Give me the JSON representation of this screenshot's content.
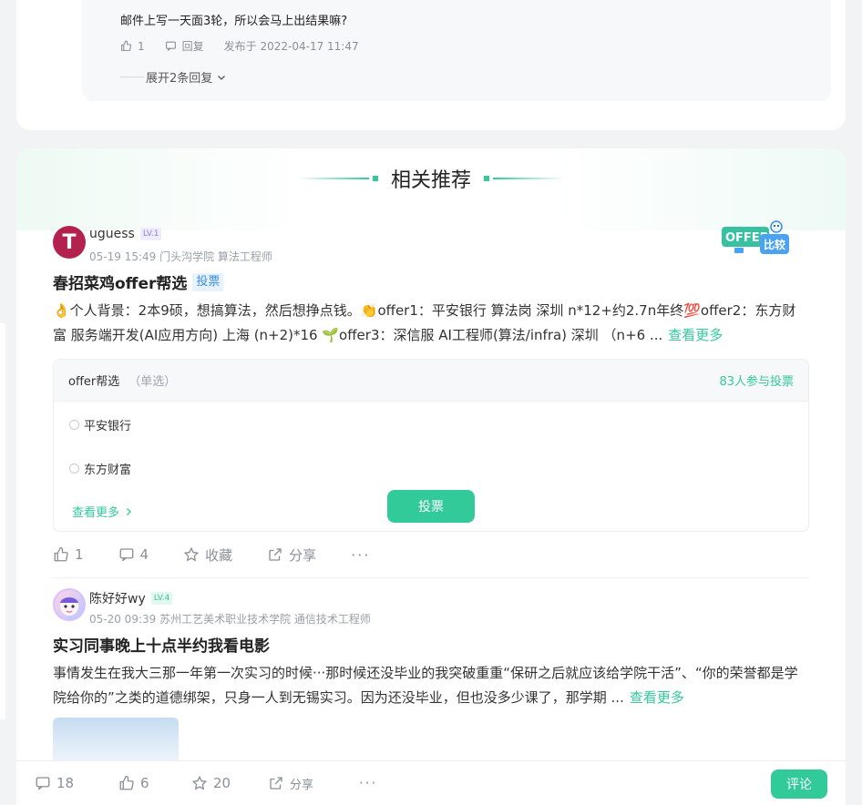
{
  "comment": {
    "reply_text": "邮件上写一天面3轮，所以会马上出结果嘛?",
    "likes": "1",
    "reply_label": "回复",
    "published": "发布于 2022-04-17 11:47",
    "expand_label": "展开2条回复"
  },
  "recommend": {
    "title": "相关推荐",
    "posts": [
      {
        "author": "uguess",
        "level": "LV.1",
        "avatar_letter": "T",
        "date_school": "05-19 15:49  门头沟学院 算法工程师",
        "title": "春招菜鸡offer帮选",
        "tag": "投票",
        "body": "👌个人背景：2本9硕，想搞算法，然后想挣点钱。👏offer1：平安银行 算法岗 深圳 n*12+约2.7n年终💯offer2：东方财富 服务端开发(AI应用方向) 上海 (n+2)*16 🌱offer3：深信服 AI工程师(算法/infra) 深圳 （n+6 ...",
        "more": "查看更多",
        "logo_text_1": "OFFER",
        "logo_text_2": "比较",
        "vote": {
          "question": "offer帮选",
          "mode": "（单选）",
          "participants": "83人参与投票",
          "options": [
            "平安银行",
            "东方财富"
          ],
          "more": "查看更多",
          "button": "投票"
        },
        "actions": {
          "likes": "1",
          "comments": "4",
          "collect": "收藏",
          "share": "分享",
          "more": "···"
        }
      },
      {
        "author": "陈好好wy",
        "level": "LV.4",
        "date_school": "05-20 09:39  苏州工艺美术职业技术学院 通信技术工程师",
        "title": "实习同事晚上十点半约我看电影",
        "body": "事情发生在我大三那一年第一次实习的时候···那时候还没毕业的我突破重重“保研之后就应该给学院干活”、“你的荣誉都是学院给你的”之类的道德绑架，只身一人到无锡实习。因为还没毕业，但也没多少课了，那学期 ...",
        "more": "查看更多"
      }
    ]
  },
  "bottom_bar": {
    "comments": "18",
    "likes": "6",
    "stars": "20",
    "share": "分享",
    "more": "···",
    "comment_button": "评论"
  },
  "colors": {
    "accent": "#32ca99",
    "tag_blue": "#3a8ee0",
    "avatar_red": "#b3214f"
  }
}
